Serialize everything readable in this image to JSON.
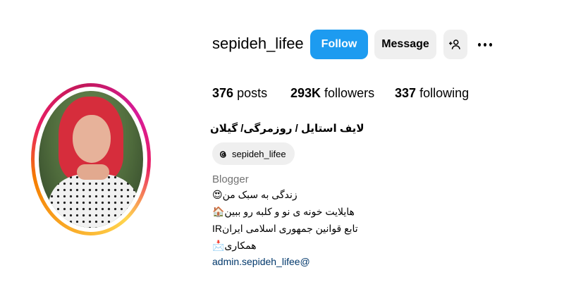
{
  "profile": {
    "username": "sepideh_lifee",
    "follow_label": "Follow",
    "message_label": "Message",
    "accent_color": "#1d9bf0"
  },
  "stats": {
    "posts_count": "376",
    "posts_label": "posts",
    "followers_count": "293K",
    "followers_label": "followers",
    "following_count": "337",
    "following_label": "following"
  },
  "bio": {
    "title": "لایف استایل / روزمرگی/ گیلان",
    "threads_handle": "sepideh_lifee",
    "category": "Blogger",
    "lines": [
      "زندگی به سبک من😍",
      "هایلایت خونه ی نو و کلبه رو ببین🏠",
      "تابع قوانین جمهوری اسلامی ایرانIR",
      "همکاری📩"
    ],
    "email": "admin.sepideh_lifee@"
  },
  "icons": {
    "add_person": "add-person-icon",
    "more": "more-options-icon",
    "threads": "threads-icon"
  }
}
